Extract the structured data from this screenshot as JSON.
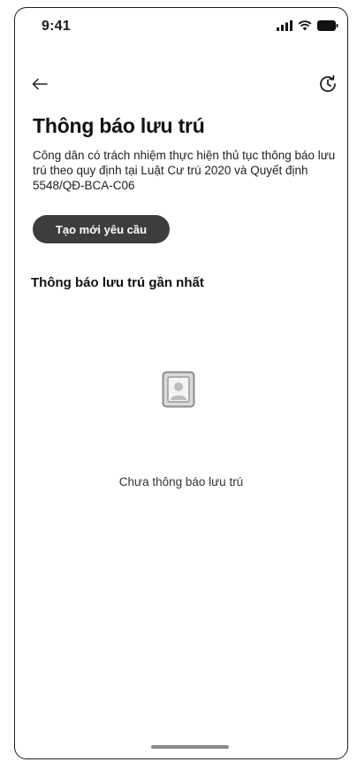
{
  "status_bar": {
    "time": "9:41"
  },
  "nav": {
    "back_icon": "arrow-left-icon",
    "history_icon": "history-clock-icon"
  },
  "page": {
    "title": "Thông báo lưu trú",
    "description": "Công dân có trách nhiệm thực hiện thủ tục thông báo lưu trú theo quy định tại Luật Cư trú 2020 và Quyết định 5548/QĐ-BCA-C06",
    "create_button_label": "Tạo mới yêu cầu",
    "section_title": "Thông báo lưu trú gần nhất"
  },
  "empty_state": {
    "icon": "empty-document-icon",
    "message": "Chưa thông báo lưu trú"
  },
  "colors": {
    "button_bg": "#3d3d3d",
    "button_text": "#ffffff",
    "text": "#111111"
  }
}
